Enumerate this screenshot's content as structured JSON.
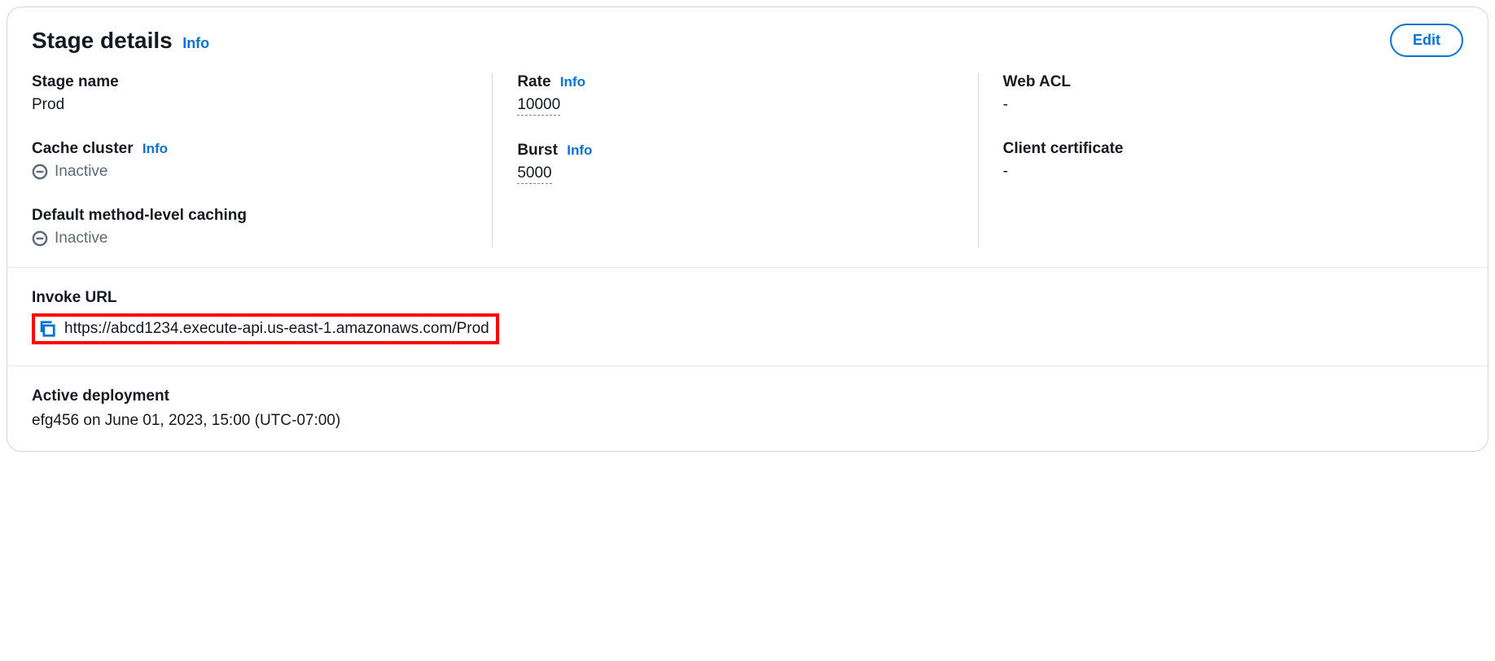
{
  "header": {
    "title": "Stage details",
    "info": "Info",
    "edit": "Edit"
  },
  "col1": {
    "stage_name_label": "Stage name",
    "stage_name_value": "Prod",
    "cache_cluster_label": "Cache cluster",
    "cache_cluster_info": "Info",
    "cache_cluster_status": "Inactive",
    "default_caching_label": "Default method-level caching",
    "default_caching_status": "Inactive"
  },
  "col2": {
    "rate_label": "Rate",
    "rate_info": "Info",
    "rate_value": "10000",
    "burst_label": "Burst",
    "burst_info": "Info",
    "burst_value": "5000"
  },
  "col3": {
    "web_acl_label": "Web ACL",
    "web_acl_value": "-",
    "client_cert_label": "Client certificate",
    "client_cert_value": "-"
  },
  "invoke": {
    "label": "Invoke URL",
    "url": "https://abcd1234.execute-api.us-east-1.amazonaws.com/Prod"
  },
  "deployment": {
    "label": "Active deployment",
    "value": "efg456 on June 01, 2023, 15:00 (UTC-07:00)"
  }
}
